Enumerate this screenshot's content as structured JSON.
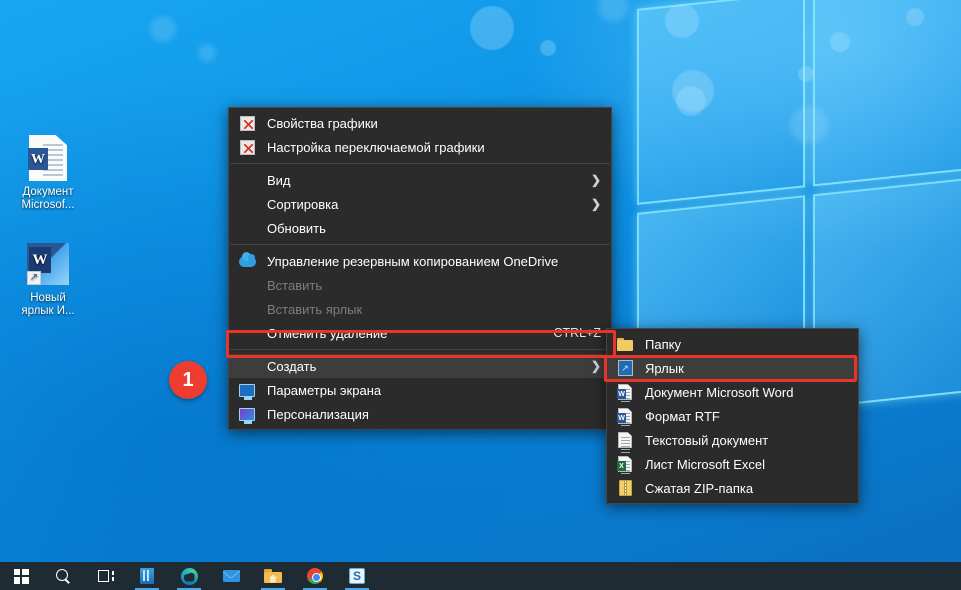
{
  "desktop": {
    "icons": [
      {
        "name": "word-document",
        "label_line1": "Документ",
        "label_line2": "Microsof...",
        "icon": "word-document-icon"
      },
      {
        "name": "word-shortcut",
        "label_line1": "Новый",
        "label_line2": "ярлык И...",
        "icon": "word-shortcut-icon"
      }
    ]
  },
  "context_menu": {
    "items": [
      {
        "label": "Свойства графики",
        "icon": "graphics-properties-icon",
        "accel": "",
        "arrow": "",
        "state": "normal"
      },
      {
        "label": "Настройка переключаемой графики",
        "icon": "switchable-graphics-icon",
        "accel": "",
        "arrow": "",
        "state": "normal"
      },
      {
        "type": "separator"
      },
      {
        "label": "Вид",
        "icon": "",
        "accel": "",
        "arrow": "❯",
        "state": "normal"
      },
      {
        "label": "Сортировка",
        "icon": "",
        "accel": "",
        "arrow": "❯",
        "state": "normal"
      },
      {
        "label": "Обновить",
        "icon": "",
        "accel": "",
        "arrow": "",
        "state": "normal"
      },
      {
        "type": "separator"
      },
      {
        "label": "Управление резервным копированием OneDrive",
        "icon": "onedrive-cloud-icon",
        "accel": "",
        "arrow": "",
        "state": "normal"
      },
      {
        "label": "Вставить",
        "icon": "",
        "accel": "",
        "arrow": "",
        "state": "disabled"
      },
      {
        "label": "Вставить ярлык",
        "icon": "",
        "accel": "",
        "arrow": "",
        "state": "disabled"
      },
      {
        "label": "Отменить удаление",
        "icon": "",
        "accel": "CTRL+Z",
        "arrow": "",
        "state": "normal"
      },
      {
        "type": "separator"
      },
      {
        "label": "Создать",
        "icon": "",
        "accel": "",
        "arrow": "❯",
        "state": "highlighted"
      },
      {
        "label": "Параметры экрана",
        "icon": "display-settings-icon",
        "accel": "",
        "arrow": "",
        "state": "normal"
      },
      {
        "label": "Персонализация",
        "icon": "personalization-icon",
        "accel": "",
        "arrow": "",
        "state": "normal"
      }
    ]
  },
  "submenu": {
    "items": [
      {
        "label": "Папку",
        "icon": "folder-icon",
        "state": "normal"
      },
      {
        "label": "Ярлык",
        "icon": "shortcut-icon",
        "state": "highlighted"
      },
      {
        "label": "Документ Microsoft Word",
        "icon": "word-file-icon",
        "state": "normal"
      },
      {
        "label": "Формат RTF",
        "icon": "rtf-file-icon",
        "state": "normal"
      },
      {
        "label": "Текстовый документ",
        "icon": "text-file-icon",
        "state": "normal"
      },
      {
        "label": "Лист Microsoft Excel",
        "icon": "excel-file-icon",
        "state": "normal"
      },
      {
        "label": "Сжатая ZIP-папка",
        "icon": "zip-folder-icon",
        "state": "normal"
      }
    ]
  },
  "annotations": {
    "step_badge": "1",
    "highlight_color": "#e8342a",
    "badge_color": "#ef3c31"
  },
  "taskbar": {
    "buttons": [
      {
        "name": "start-button",
        "icon": "windows-logo-icon",
        "active": false
      },
      {
        "name": "search-button",
        "icon": "search-icon",
        "active": false
      },
      {
        "name": "task-view-button",
        "icon": "task-view-icon",
        "active": false
      },
      {
        "name": "microsoft-store-button",
        "icon": "microsoft-store-icon",
        "active": true
      },
      {
        "name": "edge-button",
        "icon": "edge-icon",
        "active": true
      },
      {
        "name": "mail-button",
        "icon": "mail-icon",
        "active": false
      },
      {
        "name": "file-explorer-button",
        "icon": "file-explorer-icon",
        "active": true
      },
      {
        "name": "chrome-button",
        "icon": "chrome-icon",
        "active": true
      },
      {
        "name": "snipping-tool-button",
        "icon": "snipping-tool-icon",
        "label": "S",
        "active": true
      }
    ]
  },
  "theme": {
    "menu_bg": "#2b2b2b",
    "menu_border": "#454545",
    "menu_text": "#ffffff",
    "menu_disabled_text": "#7d7d7d",
    "menu_highlight": "#3d3d3d",
    "taskbar_bg": "#1f2b33",
    "desktop_blue": "#0a84d8"
  }
}
